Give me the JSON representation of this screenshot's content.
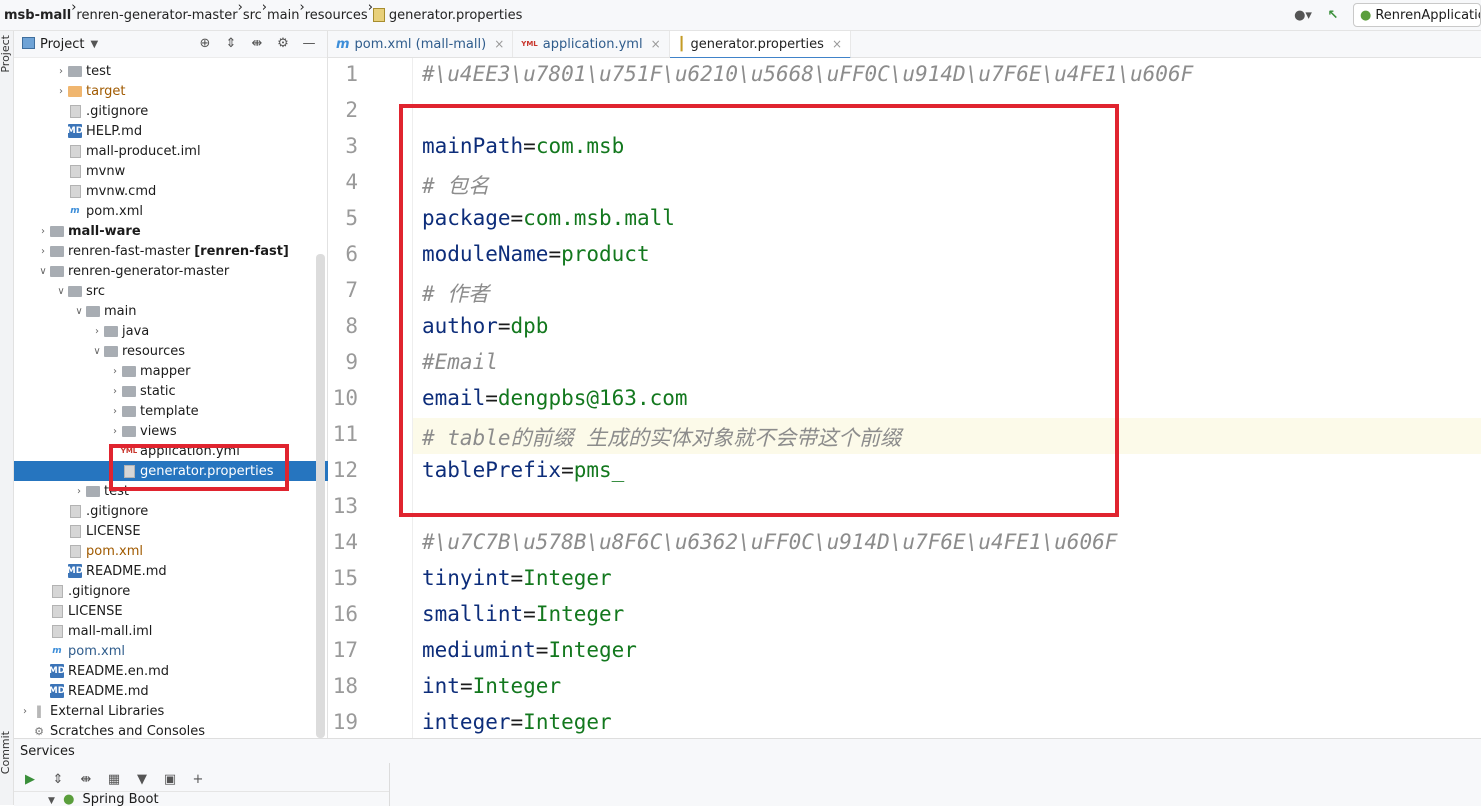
{
  "breadcrumb": [
    "msb-mall",
    "renren-generator-master",
    "src",
    "main",
    "resources",
    "generator.properties"
  ],
  "run_config": "RenrenApplicatio",
  "left_strip": {
    "project": "Project",
    "commit": "Commit"
  },
  "project_panel": {
    "title": "Project",
    "tree": [
      {
        "label": "test",
        "indent": 3,
        "arrow": "right",
        "icon": "folder"
      },
      {
        "label": "target",
        "indent": 3,
        "arrow": "right",
        "icon": "folder-orange",
        "style": "orange"
      },
      {
        "label": ".gitignore",
        "indent": 3,
        "icon": "file"
      },
      {
        "label": "HELP.md",
        "indent": 3,
        "icon": "md"
      },
      {
        "label": "mall-producet.iml",
        "indent": 3,
        "icon": "file"
      },
      {
        "label": "mvnw",
        "indent": 3,
        "icon": "file"
      },
      {
        "label": "mvnw.cmd",
        "indent": 3,
        "icon": "file"
      },
      {
        "label": "pom.xml",
        "indent": 3,
        "icon": "maven"
      },
      {
        "label": "mall-ware",
        "indent": 2,
        "arrow": "right",
        "icon": "folder",
        "style": "bold"
      },
      {
        "label": "renren-fast-master",
        "suffix": "[renren-fast]",
        "indent": 2,
        "arrow": "right",
        "icon": "folder"
      },
      {
        "label": "renren-generator-master",
        "indent": 2,
        "arrow": "down",
        "icon": "folder"
      },
      {
        "label": "src",
        "indent": 3,
        "arrow": "down",
        "icon": "folder"
      },
      {
        "label": "main",
        "indent": 4,
        "arrow": "down",
        "icon": "folder"
      },
      {
        "label": "java",
        "indent": 5,
        "arrow": "right",
        "icon": "folder"
      },
      {
        "label": "resources",
        "indent": 5,
        "arrow": "down",
        "icon": "folder"
      },
      {
        "label": "mapper",
        "indent": 6,
        "arrow": "right",
        "icon": "folder"
      },
      {
        "label": "static",
        "indent": 6,
        "arrow": "right",
        "icon": "folder"
      },
      {
        "label": "template",
        "indent": 6,
        "arrow": "right",
        "icon": "folder"
      },
      {
        "label": "views",
        "indent": 6,
        "arrow": "right",
        "icon": "folder"
      },
      {
        "label": "application.yml",
        "indent": 6,
        "icon": "yml"
      },
      {
        "label": "generator.properties",
        "indent": 6,
        "icon": "file",
        "style": "selected"
      },
      {
        "label": "test",
        "indent": 4,
        "arrow": "right",
        "icon": "folder"
      },
      {
        "label": ".gitignore",
        "indent": 3,
        "icon": "file"
      },
      {
        "label": "LICENSE",
        "indent": 3,
        "icon": "file"
      },
      {
        "label": "pom.xml",
        "indent": 3,
        "icon": "file",
        "style": "orange"
      },
      {
        "label": "README.md",
        "indent": 3,
        "icon": "md"
      },
      {
        "label": ".gitignore",
        "indent": 2,
        "icon": "file"
      },
      {
        "label": "LICENSE",
        "indent": 2,
        "icon": "file"
      },
      {
        "label": "mall-mall.iml",
        "indent": 2,
        "icon": "file"
      },
      {
        "label": "pom.xml",
        "indent": 2,
        "icon": "maven",
        "style": "blue"
      },
      {
        "label": "README.en.md",
        "indent": 2,
        "icon": "md"
      },
      {
        "label": "README.md",
        "indent": 2,
        "icon": "md"
      },
      {
        "label": "External Libraries",
        "indent": 1,
        "arrow": "right",
        "icon": "lib"
      },
      {
        "label": "Scratches and Consoles",
        "indent": 1,
        "icon": "scratch"
      }
    ]
  },
  "tabs": [
    {
      "label": "pom.xml (mall-mall)",
      "icon": "m"
    },
    {
      "label": "application.yml",
      "icon": "yml"
    },
    {
      "label": "generator.properties",
      "icon": "prop",
      "active": true
    }
  ],
  "editor": {
    "current_line": 11,
    "lines": [
      {
        "n": "1",
        "parts": [
          [
            "c",
            "#\\u4EE3\\u7801\\u751F\\u6210\\u5668\\uFF0C\\u914D\\u7F6E\\u4FE1\\u606F"
          ]
        ]
      },
      {
        "n": "2",
        "parts": []
      },
      {
        "n": "3",
        "parts": [
          [
            "k",
            "mainPath"
          ],
          [
            "p",
            "="
          ],
          [
            "v",
            "com.msb"
          ]
        ]
      },
      {
        "n": "4",
        "parts": [
          [
            "c",
            "# 包名"
          ]
        ]
      },
      {
        "n": "5",
        "parts": [
          [
            "k",
            "package"
          ],
          [
            "p",
            "="
          ],
          [
            "v",
            "com.msb.mall"
          ]
        ]
      },
      {
        "n": "6",
        "parts": [
          [
            "k",
            "moduleName"
          ],
          [
            "p",
            "="
          ],
          [
            "v",
            "product"
          ]
        ]
      },
      {
        "n": "7",
        "parts": [
          [
            "c",
            "# 作者"
          ]
        ]
      },
      {
        "n": "8",
        "parts": [
          [
            "k",
            "author"
          ],
          [
            "p",
            "="
          ],
          [
            "v",
            "dpb"
          ]
        ]
      },
      {
        "n": "9",
        "parts": [
          [
            "c",
            "#Email"
          ]
        ]
      },
      {
        "n": "10",
        "parts": [
          [
            "k",
            "email"
          ],
          [
            "p",
            "="
          ],
          [
            "v",
            "dengpbs@163.com"
          ]
        ]
      },
      {
        "n": "11",
        "parts": [
          [
            "c",
            "# table的前缀 生成的实体对象就不会带这个前缀"
          ]
        ]
      },
      {
        "n": "12",
        "parts": [
          [
            "k",
            "tablePrefix"
          ],
          [
            "p",
            "="
          ],
          [
            "v",
            "pms_"
          ]
        ]
      },
      {
        "n": "13",
        "parts": []
      },
      {
        "n": "14",
        "parts": [
          [
            "c",
            "#\\u7C7B\\u578B\\u8F6C\\u6362\\uFF0C\\u914D\\u7F6E\\u4FE1\\u606F"
          ]
        ]
      },
      {
        "n": "15",
        "parts": [
          [
            "k",
            "tinyint"
          ],
          [
            "p",
            "="
          ],
          [
            "v",
            "Integer"
          ]
        ]
      },
      {
        "n": "16",
        "parts": [
          [
            "k",
            "smallint"
          ],
          [
            "p",
            "="
          ],
          [
            "v",
            "Integer"
          ]
        ]
      },
      {
        "n": "17",
        "parts": [
          [
            "k",
            "mediumint"
          ],
          [
            "p",
            "="
          ],
          [
            "v",
            "Integer"
          ]
        ]
      },
      {
        "n": "18",
        "parts": [
          [
            "k",
            "int"
          ],
          [
            "p",
            "="
          ],
          [
            "v",
            "Integer"
          ]
        ]
      },
      {
        "n": "19",
        "parts": [
          [
            "k",
            "integer"
          ],
          [
            "p",
            "="
          ],
          [
            "v",
            "Integer"
          ]
        ]
      }
    ]
  },
  "services": {
    "title": "Services",
    "sub_item": "Spring Boot"
  },
  "colors": {
    "selection": "#2675bf",
    "annotation": "#e0242f",
    "key": "#0d2d7a",
    "value": "#13781e",
    "comment": "#8c8c8c"
  }
}
